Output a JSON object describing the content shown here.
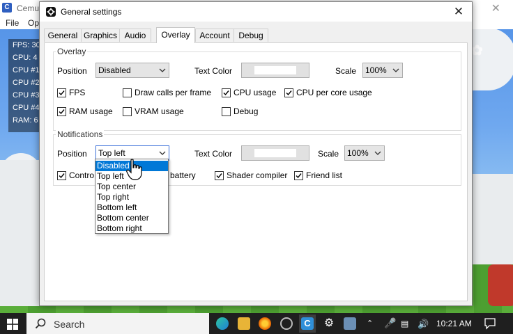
{
  "background": {
    "app_title": "Cemu",
    "menu": [
      "File",
      "Op"
    ],
    "hud_lines": [
      "FPS: 30",
      "CPU: 4",
      "CPU #1",
      "CPU #2",
      "CPU #3",
      "CPU #4",
      "RAM: 6"
    ]
  },
  "dialog": {
    "title": "General settings",
    "tabs": [
      "General",
      "Graphics",
      "Audio",
      "Overlay",
      "Account",
      "Debug"
    ],
    "active_tab": "Overlay",
    "overlay": {
      "group_label": "Overlay",
      "position_label": "Position",
      "position_value": "Disabled",
      "text_color_label": "Text Color",
      "scale_label": "Scale",
      "scale_value": "100%",
      "checks": [
        {
          "label": "FPS",
          "checked": true
        },
        {
          "label": "Draw calls per frame",
          "checked": false
        },
        {
          "label": "CPU usage",
          "checked": true
        },
        {
          "label": "CPU per core usage",
          "checked": true
        },
        {
          "label": "RAM usage",
          "checked": true
        },
        {
          "label": "VRAM usage",
          "checked": false
        },
        {
          "label": "Debug",
          "checked": false
        }
      ]
    },
    "notifications": {
      "group_label": "Notifications",
      "position_label": "Position",
      "position_value": "Top left",
      "text_color_label": "Text Color",
      "scale_label": "Scale",
      "scale_value": "100%",
      "checks": [
        {
          "label": "Controller battery",
          "visible_label": "Contro",
          "checked": true
        },
        {
          "label": "Low battery",
          "visible_label": "w battery",
          "checked": true
        },
        {
          "label": "Shader compiler",
          "checked": true
        },
        {
          "label": "Friend list",
          "checked": true
        }
      ]
    },
    "dropdown_options": [
      "Disabled",
      "Top left",
      "Top center",
      "Top right",
      "Bottom left",
      "Bottom center",
      "Bottom right"
    ],
    "dropdown_highlighted": "Disabled"
  },
  "taskbar": {
    "search_label": "Search",
    "time": "10:21 AM"
  },
  "colors": {
    "accent": "#0078d7",
    "taskbar": "#1f1f1f"
  }
}
